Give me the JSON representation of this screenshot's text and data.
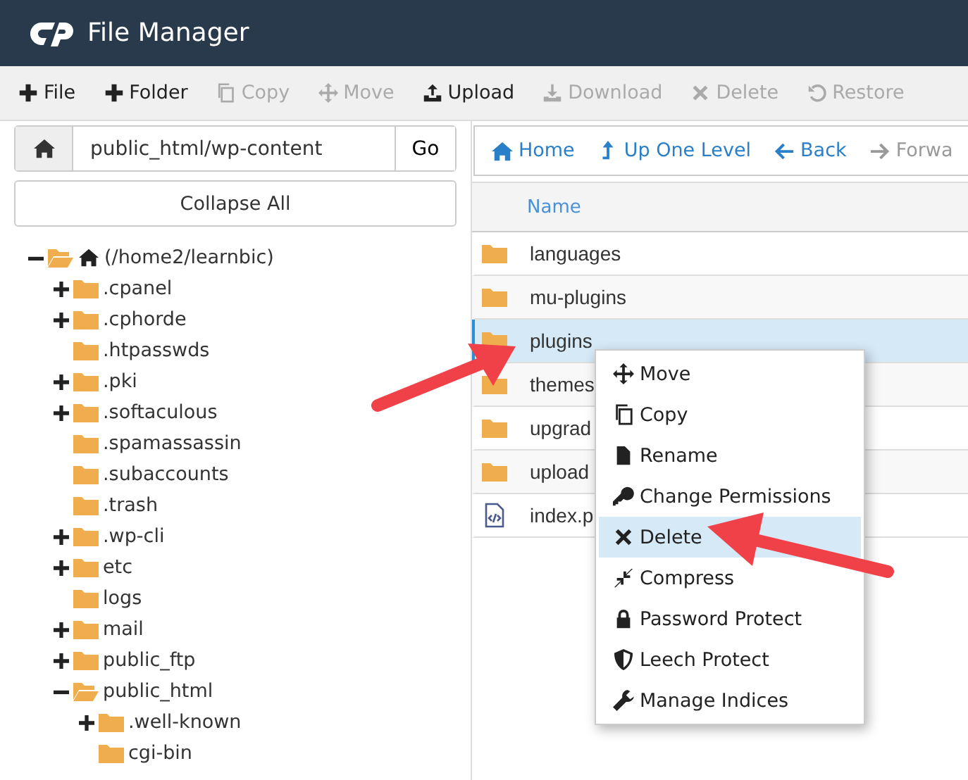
{
  "app": {
    "title": "File Manager"
  },
  "toolbar": [
    {
      "label": "File",
      "kind": "plus",
      "disabled": false
    },
    {
      "label": "Folder",
      "kind": "plus",
      "disabled": false
    },
    {
      "label": "Copy",
      "kind": "copy",
      "disabled": true
    },
    {
      "label": "Move",
      "kind": "move",
      "disabled": true
    },
    {
      "label": "Upload",
      "kind": "upload",
      "disabled": false
    },
    {
      "label": "Download",
      "kind": "download",
      "disabled": true
    },
    {
      "label": "Delete",
      "kind": "delete",
      "disabled": true
    },
    {
      "label": "Restore",
      "kind": "restore",
      "disabled": true
    }
  ],
  "path": {
    "value": "public_html/wp-content",
    "go": "Go"
  },
  "collapse_all": "Collapse All",
  "tree": [
    {
      "label": "(/home2/learnbic)",
      "root": true,
      "expandable": true,
      "expanded": true,
      "children": [
        {
          "label": ".cpanel",
          "expandable": true,
          "expanded": false
        },
        {
          "label": ".cphorde",
          "expandable": true,
          "expanded": false
        },
        {
          "label": ".htpasswds",
          "expandable": false,
          "expanded": false
        },
        {
          "label": ".pki",
          "expandable": true,
          "expanded": false
        },
        {
          "label": ".softaculous",
          "expandable": true,
          "expanded": false
        },
        {
          "label": ".spamassassin",
          "expandable": false,
          "expanded": false
        },
        {
          "label": ".subaccounts",
          "expandable": false,
          "expanded": false
        },
        {
          "label": ".trash",
          "expandable": false,
          "expanded": false
        },
        {
          "label": ".wp-cli",
          "expandable": true,
          "expanded": false
        },
        {
          "label": "etc",
          "expandable": true,
          "expanded": false
        },
        {
          "label": "logs",
          "expandable": false,
          "expanded": false
        },
        {
          "label": "mail",
          "expandable": true,
          "expanded": false
        },
        {
          "label": "public_ftp",
          "expandable": true,
          "expanded": false
        },
        {
          "label": "public_html",
          "expandable": true,
          "expanded": true,
          "children": [
            {
              "label": ".well-known",
              "expandable": true,
              "expanded": false
            },
            {
              "label": "cgi-bin",
              "expandable": false,
              "expanded": false
            }
          ]
        }
      ]
    }
  ],
  "nav": [
    {
      "label": "Home",
      "kind": "home",
      "disabled": false
    },
    {
      "label": "Up One Level",
      "kind": "up",
      "disabled": false
    },
    {
      "label": "Back",
      "kind": "back",
      "disabled": false
    },
    {
      "label": "Forwa",
      "kind": "forward",
      "disabled": true
    }
  ],
  "table": {
    "columns": [
      "Name"
    ],
    "rows": [
      {
        "name": "languages",
        "kind": "folder",
        "selected": false
      },
      {
        "name": "mu-plugins",
        "kind": "folder",
        "selected": false
      },
      {
        "name": "plugins",
        "kind": "folder",
        "selected": true
      },
      {
        "name": "themes",
        "kind": "folder",
        "selected": false
      },
      {
        "name": "upgrad",
        "kind": "folder",
        "selected": false
      },
      {
        "name": "upload",
        "kind": "folder",
        "selected": false
      },
      {
        "name": "index.p",
        "kind": "code",
        "selected": false
      }
    ]
  },
  "context_menu": [
    {
      "label": "Move",
      "kind": "move",
      "selected": false
    },
    {
      "label": "Copy",
      "kind": "copy",
      "selected": false
    },
    {
      "label": "Rename",
      "kind": "rename",
      "selected": false
    },
    {
      "label": "Change Permissions",
      "kind": "key",
      "selected": false
    },
    {
      "label": "Delete",
      "kind": "delete",
      "selected": true
    },
    {
      "label": "Compress",
      "kind": "compress",
      "selected": false
    },
    {
      "label": "Password Protect",
      "kind": "lock",
      "selected": false
    },
    {
      "label": "Leech Protect",
      "kind": "shield",
      "selected": false
    },
    {
      "label": "Manage Indices",
      "kind": "wrench",
      "selected": false
    }
  ]
}
